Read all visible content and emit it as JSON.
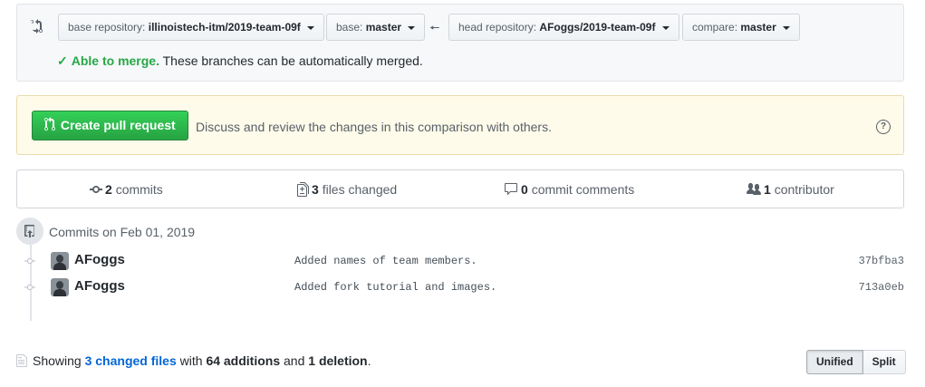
{
  "range": {
    "base_repo_key": "base repository:",
    "base_repo_value": "illinoistech-itm/2019-team-09f",
    "base_key": "base:",
    "base_value": "master",
    "head_repo_key": "head repository:",
    "head_repo_value": "AFoggs/2019-team-09f",
    "compare_key": "compare:",
    "compare_value": "master",
    "merge_ok": "Able to merge.",
    "merge_msg": "These branches can be automatically merged."
  },
  "create_pr": {
    "button_label": "Create pull request",
    "message": "Discuss and review the changes in this comparison with others.",
    "help_glyph": "?"
  },
  "numbers": {
    "commits_count": "2",
    "commits_label": "commits",
    "files_count": "3",
    "files_label": "files changed",
    "comments_count": "0",
    "comments_label": "commit comments",
    "contributors_count": "1",
    "contributors_label": "contributor"
  },
  "commits": {
    "group_title": "Commits on Feb 01, 2019",
    "items": [
      {
        "author": "AFoggs",
        "message": "Added names of team members.",
        "sha": "37bfba3"
      },
      {
        "author": "AFoggs",
        "message": "Added fork tutorial and images.",
        "sha": "713a0eb"
      }
    ]
  },
  "toc": {
    "prefix": "Showing",
    "files_link": "3 changed files",
    "with": "with",
    "additions": "64 additions",
    "and": "and",
    "deletions": "1 deletion",
    "period": "."
  },
  "view_toggle": {
    "unified": "Unified",
    "split": "Split"
  }
}
